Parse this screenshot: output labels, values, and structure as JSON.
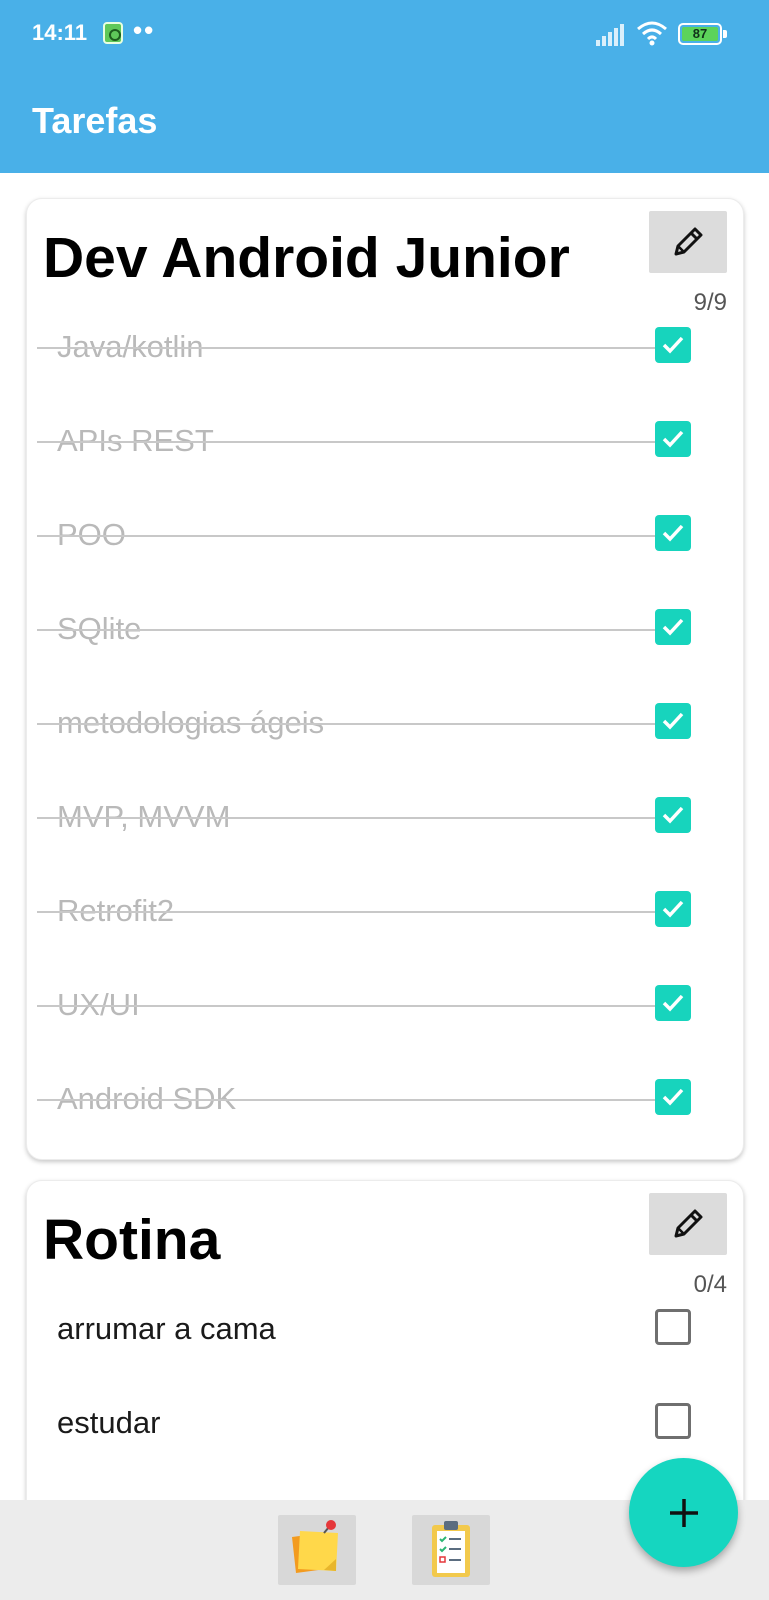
{
  "status_bar": {
    "time": "14:11",
    "dots": "••",
    "battery": "87",
    "battery_color": "#5cd35a"
  },
  "app_bar": {
    "title": "Tarefas",
    "color": "#49b0e8"
  },
  "lists": [
    {
      "title": "Dev Android Junior",
      "progress": "9/9",
      "edit_icon": "pencil-icon",
      "items": [
        {
          "label": "Java/kotlin",
          "checked": true
        },
        {
          "label": "APIs REST",
          "checked": true
        },
        {
          "label": "POO",
          "checked": true
        },
        {
          "label": "SQlite",
          "checked": true
        },
        {
          "label": "metodologias ágeis",
          "checked": true
        },
        {
          "label": "MVP, MVVM",
          "checked": true
        },
        {
          "label": "Retrofit2",
          "checked": true
        },
        {
          "label": "UX/UI",
          "checked": true
        },
        {
          "label": "Android SDK",
          "checked": true
        }
      ]
    },
    {
      "title": "Rotina",
      "progress": "0/4",
      "edit_icon": "pencil-icon",
      "items": [
        {
          "label": "arrumar a cama",
          "checked": false
        },
        {
          "label": "estudar",
          "checked": false
        }
      ]
    }
  ],
  "bottom_nav": {
    "items": [
      {
        "icon": "sticky-note-icon"
      },
      {
        "icon": "clipboard-checklist-icon"
      }
    ]
  },
  "fab": {
    "icon": "plus-icon",
    "color": "#15d6c0"
  },
  "accent_color": "#17d4bd"
}
